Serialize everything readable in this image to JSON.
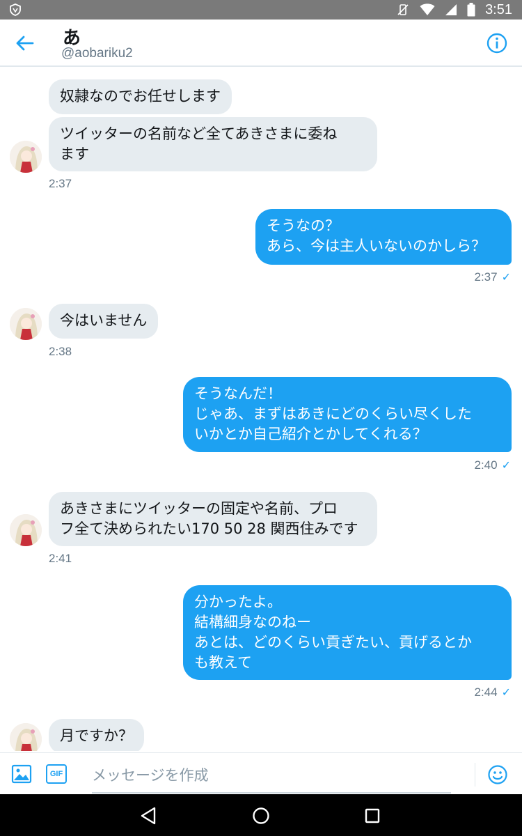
{
  "status_bar": {
    "time": "3:51"
  },
  "header": {
    "title": "あ",
    "handle": "@aobariku2",
    "back_icon": "arrow-left-icon",
    "info_icon": "info-icon"
  },
  "colors": {
    "accent": "#1da1f2",
    "incoming_bubble": "#e6ecf0",
    "muted_text": "#657786"
  },
  "messages": [
    {
      "direction": "in",
      "text": "奴隷なのでお任せします"
    },
    {
      "direction": "in",
      "text": "ツイッターの名前など全てあきさまに委ね\nます",
      "time": "2:37"
    },
    {
      "direction": "out",
      "text": "そうなの？\nあら、今は主人いないのかしら？",
      "time": "2:37"
    },
    {
      "direction": "in",
      "text": "今はいません",
      "time": "2:38"
    },
    {
      "direction": "out",
      "text": "そうなんだ！\nじゃあ、まずはあきにどのくらい尽くした\nいかとか自己紹介とかしてくれる？",
      "time": "2:40"
    },
    {
      "direction": "in",
      "text": "あきさまにツイッターの固定や名前、プロ\nフ全て決められたい170 50 28 関西住みです",
      "time": "2:41"
    },
    {
      "direction": "out",
      "text": "分かったよ。\n結構細身なのねー\nあとは、どのくらい貢ぎたい、貢げるとか\nも教えて",
      "time": "2:44"
    },
    {
      "direction": "in",
      "text": "月ですか？"
    }
  ],
  "composer": {
    "placeholder": "メッセージを作成",
    "gif_label": "GIF",
    "image_icon": "image-icon",
    "emoji_icon": "emoji-icon"
  },
  "read_mark": "✓"
}
